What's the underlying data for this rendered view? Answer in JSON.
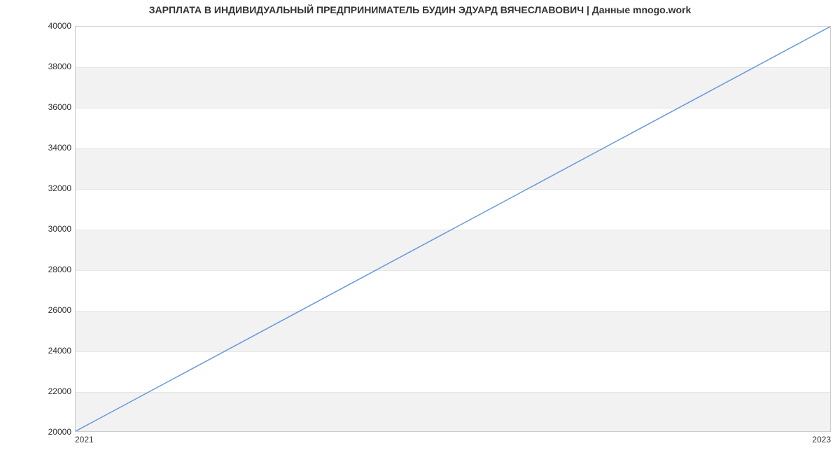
{
  "chart_data": {
    "type": "line",
    "title": "ЗАРПЛАТА В ИНДИВИДУАЛЬНЫЙ ПРЕДПРИНИМАТЕЛЬ БУДИН ЭДУАРД ВЯЧЕСЛАВОВИЧ | Данные mnogo.work",
    "x": [
      2021,
      2023
    ],
    "values": [
      20000,
      40000
    ],
    "xlabel": "",
    "ylabel": "",
    "xlim": [
      2021,
      2023
    ],
    "ylim": [
      20000,
      40000
    ],
    "x_ticks": [
      2021,
      2023
    ],
    "y_ticks": [
      20000,
      22000,
      24000,
      26000,
      28000,
      30000,
      32000,
      34000,
      36000,
      38000,
      40000
    ],
    "line_color": "#6699dd",
    "band_color": "#f2f2f2",
    "grid": true,
    "legend": false
  }
}
